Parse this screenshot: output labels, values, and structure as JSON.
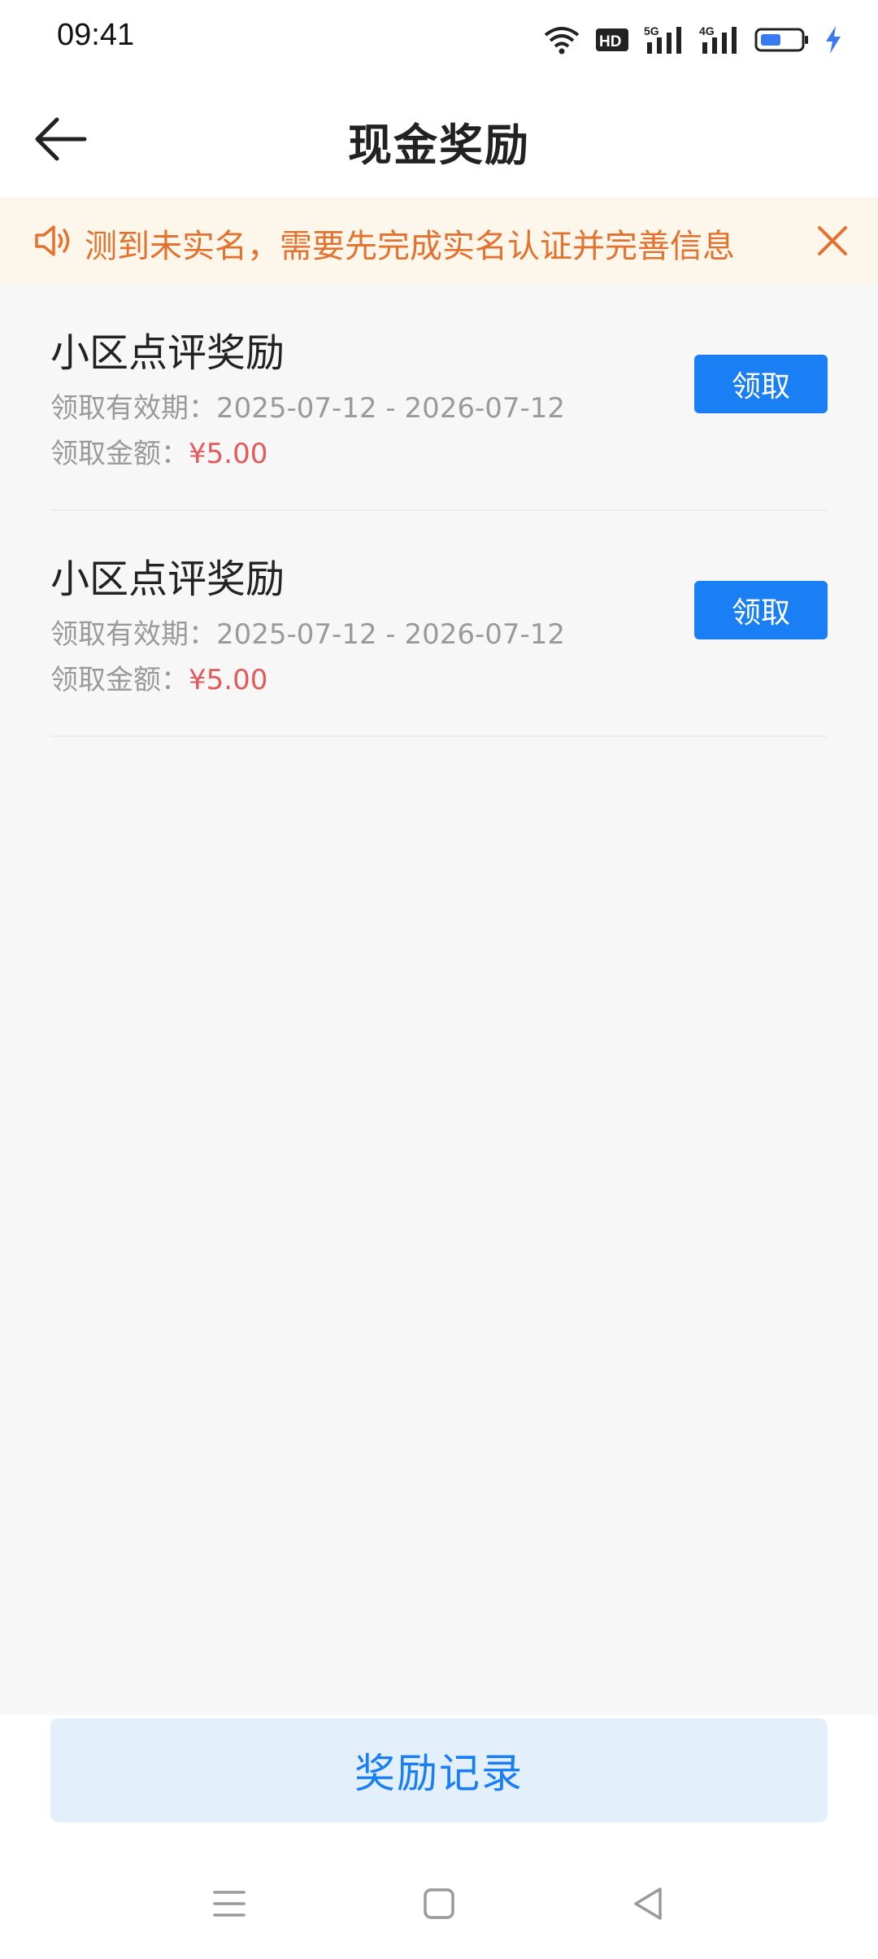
{
  "status_bar": {
    "time": "09:41",
    "icons": [
      "wifi-icon",
      "hd-icon",
      "5g-signal-icon",
      "4g-signal-icon",
      "battery-icon",
      "charging-icon"
    ],
    "hd_label": "HD",
    "net1_label": "5G",
    "net2_label": "4G"
  },
  "header": {
    "title": "现金奖励",
    "back_icon": "arrow-left-icon"
  },
  "notice": {
    "text": "测到未实名，需要先完成实名认证并完善信息",
    "icon": "speaker-icon",
    "close_icon": "close-icon",
    "color": "#e4722f",
    "background": "#fdf6ea"
  },
  "rewards": [
    {
      "title": "小区点评奖励",
      "period_label": "领取有效期：",
      "period_value": "2025-07-12 - 2026-07-12",
      "amount_label": "领取金额：",
      "amount_value": "¥5.00",
      "button_label": "领取"
    },
    {
      "title": "小区点评奖励",
      "period_label": "领取有效期：",
      "period_value": "2025-07-12 - 2026-07-12",
      "amount_label": "领取金额：",
      "amount_value": "¥5.00",
      "button_label": "领取"
    }
  ],
  "footer": {
    "record_button_label": "奖励记录"
  },
  "system_nav": {
    "icons": [
      "menu-icon",
      "home-icon",
      "back-triangle-icon"
    ]
  },
  "colors": {
    "accent": "#1a7ef5",
    "amount": "#e35a5a",
    "record_button_bg": "#e3f0fc"
  }
}
